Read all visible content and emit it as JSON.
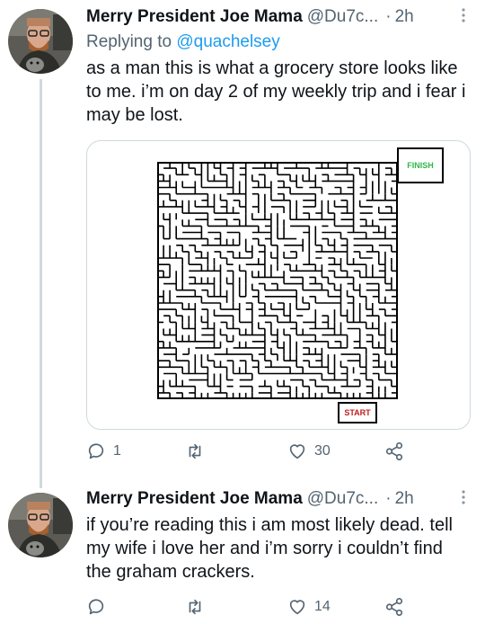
{
  "tweets": [
    {
      "name": "Merry President Joe Mama",
      "handle": "@Du7c...",
      "separator": "·",
      "time": "2h",
      "replying_to_label": "Replying to",
      "replying_to_handle": "@quachelsey",
      "text": "as a man this is what a grocery store looks like to me. i’m on day 2 of my weekly trip and i fear i may be lost.",
      "media": {
        "finish_label": "FINISH",
        "start_label": "START"
      },
      "actions": {
        "replies": "1",
        "retweets": "",
        "likes": "30"
      }
    },
    {
      "name": "Merry President Joe Mama",
      "handle": "@Du7c...",
      "separator": "·",
      "time": "2h",
      "text": "if you’re reading this i am most likely dead. tell my wife i love her and i’m sorry i couldn’t find the graham crackers.",
      "actions": {
        "replies": "",
        "retweets": "",
        "likes": "14"
      }
    }
  ],
  "icons": {
    "reply": "reply-icon",
    "retweet": "retweet-icon",
    "like": "like-icon",
    "share": "share-icon",
    "more": "more-icon"
  },
  "colors": {
    "link": "#1d9bf0",
    "secondary": "#536471",
    "finish": "#2fb84a",
    "start": "#c01b1b"
  }
}
